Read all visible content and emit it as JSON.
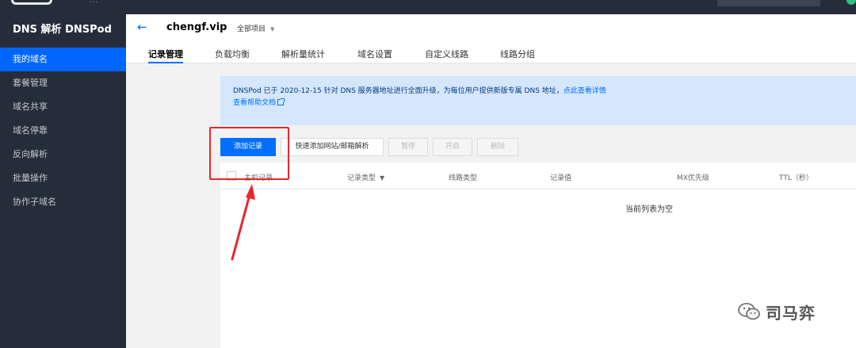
{
  "sidebar": {
    "brand": "DNS 解析 DNSPod",
    "items": [
      {
        "label": "我的域名",
        "active": true
      },
      {
        "label": "套餐管理"
      },
      {
        "label": "域名共享"
      },
      {
        "label": "域名停靠"
      },
      {
        "label": "反向解析"
      },
      {
        "label": "批量操作"
      },
      {
        "label": "协作子域名"
      }
    ]
  },
  "header": {
    "domain": "chengf.vip",
    "project": "全部项目",
    "tabs": [
      {
        "label": "记录管理",
        "active": true
      },
      {
        "label": "负载均衡"
      },
      {
        "label": "解析量统计"
      },
      {
        "label": "域名设置"
      },
      {
        "label": "自定义线路"
      },
      {
        "label": "线路分组"
      }
    ]
  },
  "notice": {
    "text": "DNSPod 已于 2020-12-15 针对 DNS 服务器地址进行全面升级，为每位用户提供新版专属 DNS 地址，",
    "link": "点此查看详情",
    "help": "查看帮助文档"
  },
  "toolbar": {
    "add": "添加记录",
    "quick_add": "快速添加网站/邮箱解析",
    "pause": "暂停",
    "enable": "开启",
    "delete": "删除"
  },
  "table": {
    "columns": [
      "主机记录",
      "记录类型",
      "线路类型",
      "记录值",
      "MX优先级",
      "TTL（秒）"
    ],
    "empty": "当前列表为空"
  },
  "watermark": "司马弈",
  "colors": {
    "accent": "#006eff",
    "sidebar": "#262d3a",
    "annotation": "#e8262b"
  }
}
